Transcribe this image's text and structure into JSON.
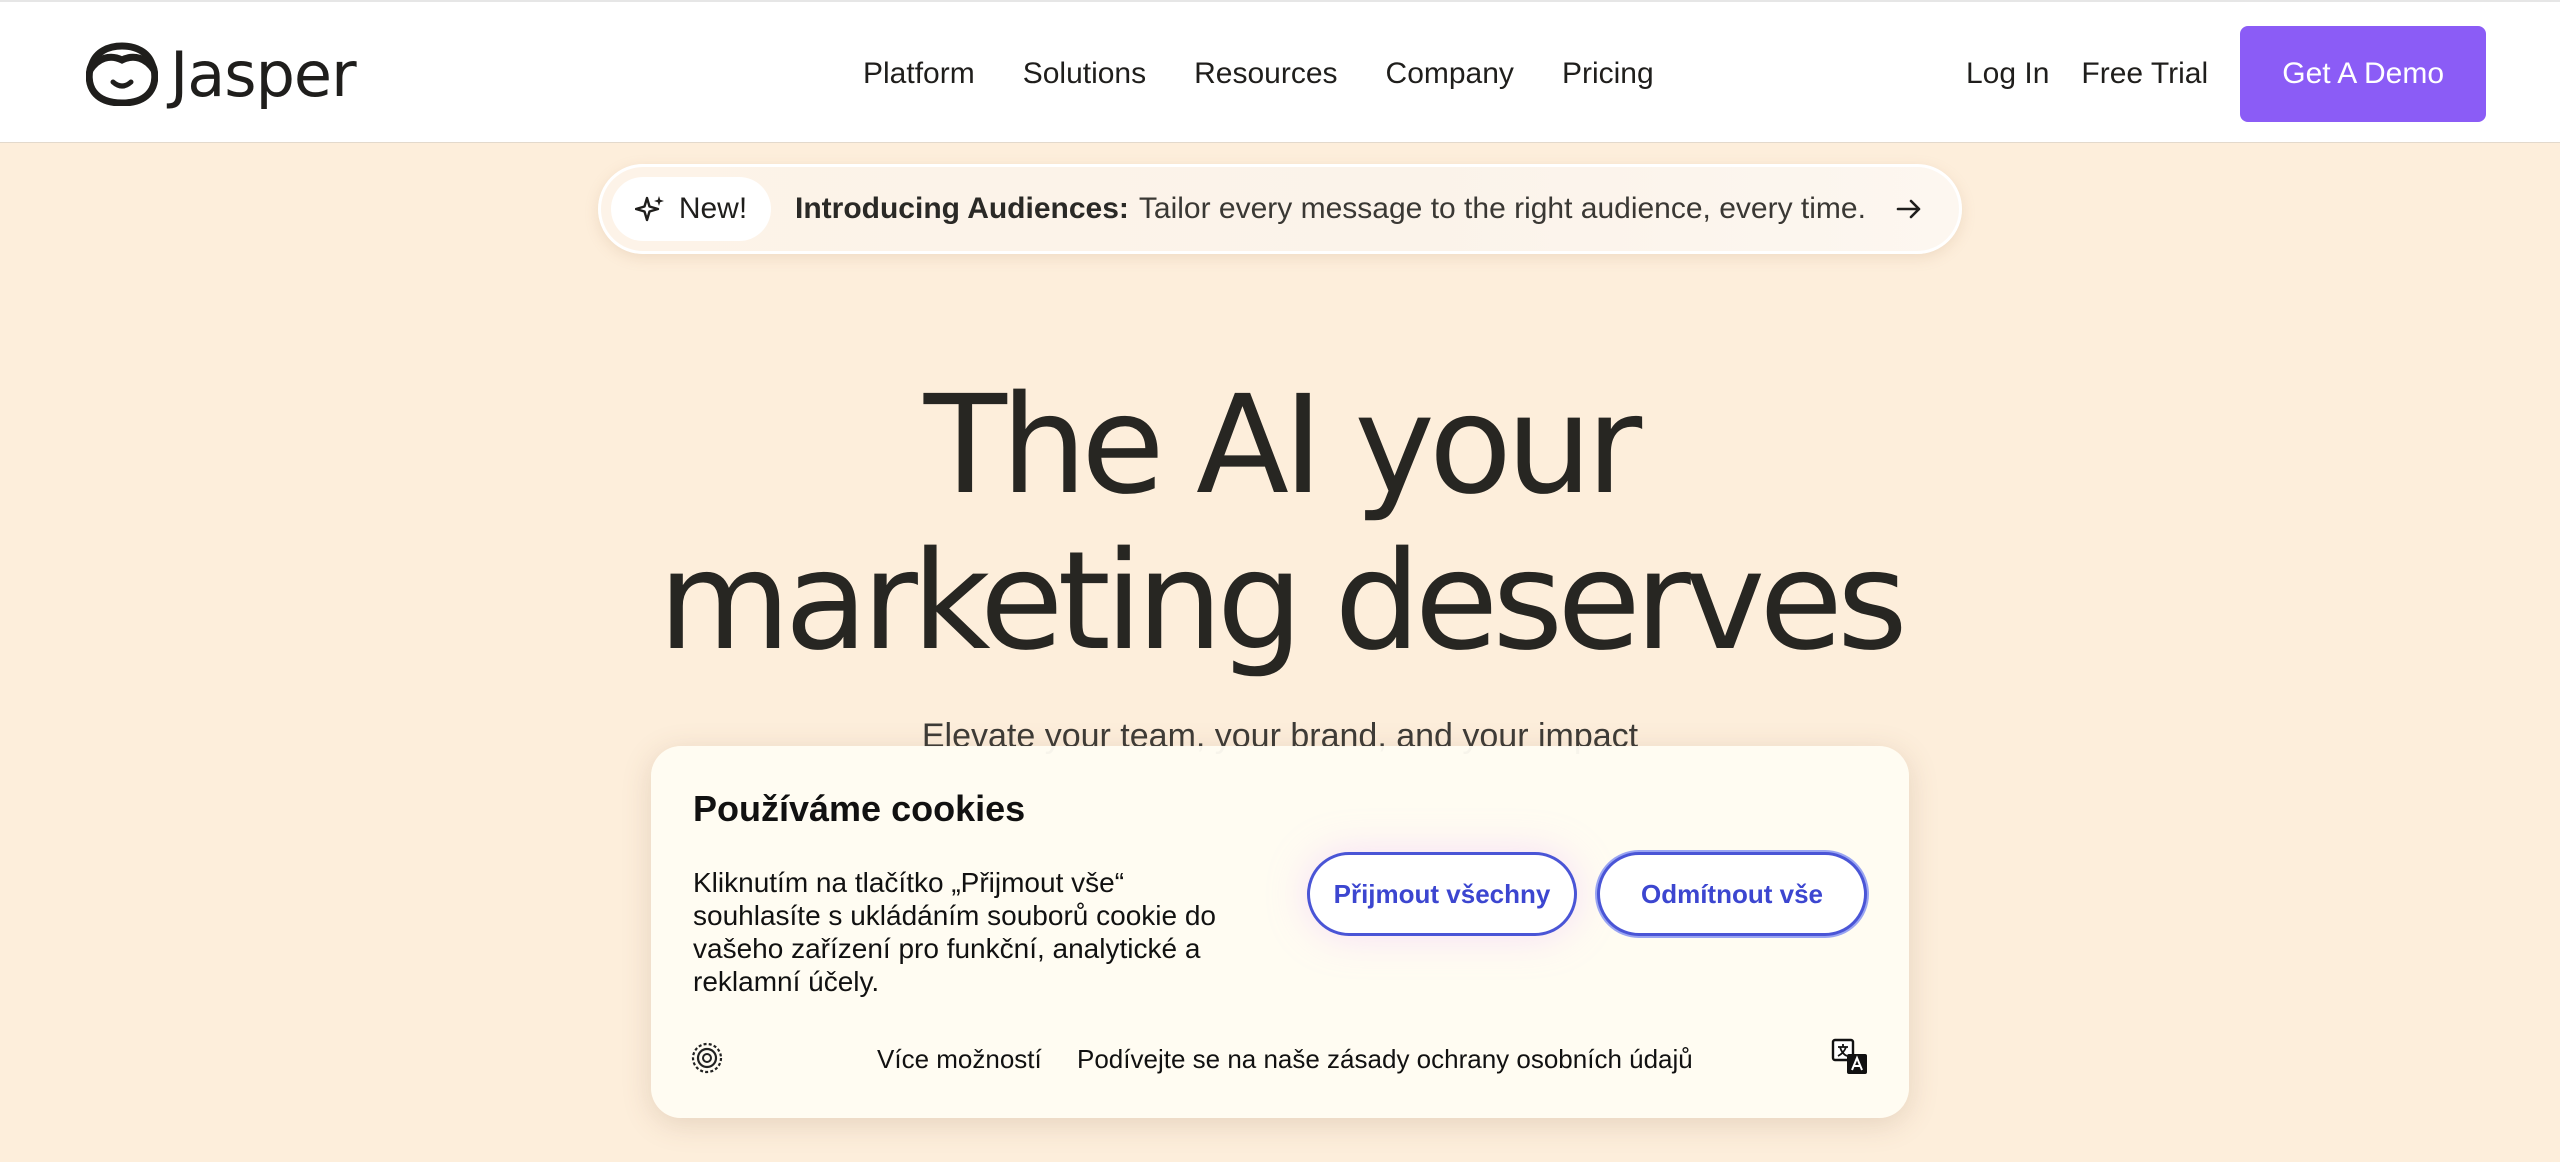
{
  "header": {
    "logo_text": "Jasper",
    "nav": [
      "Platform",
      "Solutions",
      "Resources",
      "Company",
      "Pricing"
    ],
    "login": "Log In",
    "free_trial": "Free Trial",
    "demo": "Get A Demo"
  },
  "announcement": {
    "badge": "New!",
    "title": "Introducing Audiences:",
    "text": "Tailor every message to the right audience, every time."
  },
  "hero": {
    "title_line1": "The AI your",
    "title_line2": "marketing deserves",
    "subtitle": "Elevate your team, your brand, and your impact"
  },
  "cookie": {
    "title": "Používáme cookies",
    "body": "Kliknutím na tlačítko „Přijmout vše“ souhlasíte s ukládáním souborů cookie do vašeho zařízení pro funkční, analytické a reklamní účely.",
    "accept": "Přijmout všechny",
    "reject": "Odmítnout vše",
    "more_options": "Více možností",
    "privacy": "Podívejte se na naše zásady ochrany osobních údajů"
  },
  "colors": {
    "page_bg": "#fdeedb",
    "brand_purple": "#8b5cf6",
    "cookie_button_blue": "#4a55d6",
    "text_dark": "#272622"
  },
  "icons": [
    "jasper-logo-icon",
    "sparkle-icon",
    "arrow-right-icon",
    "cookie-settings-icon",
    "translate-icon"
  ]
}
